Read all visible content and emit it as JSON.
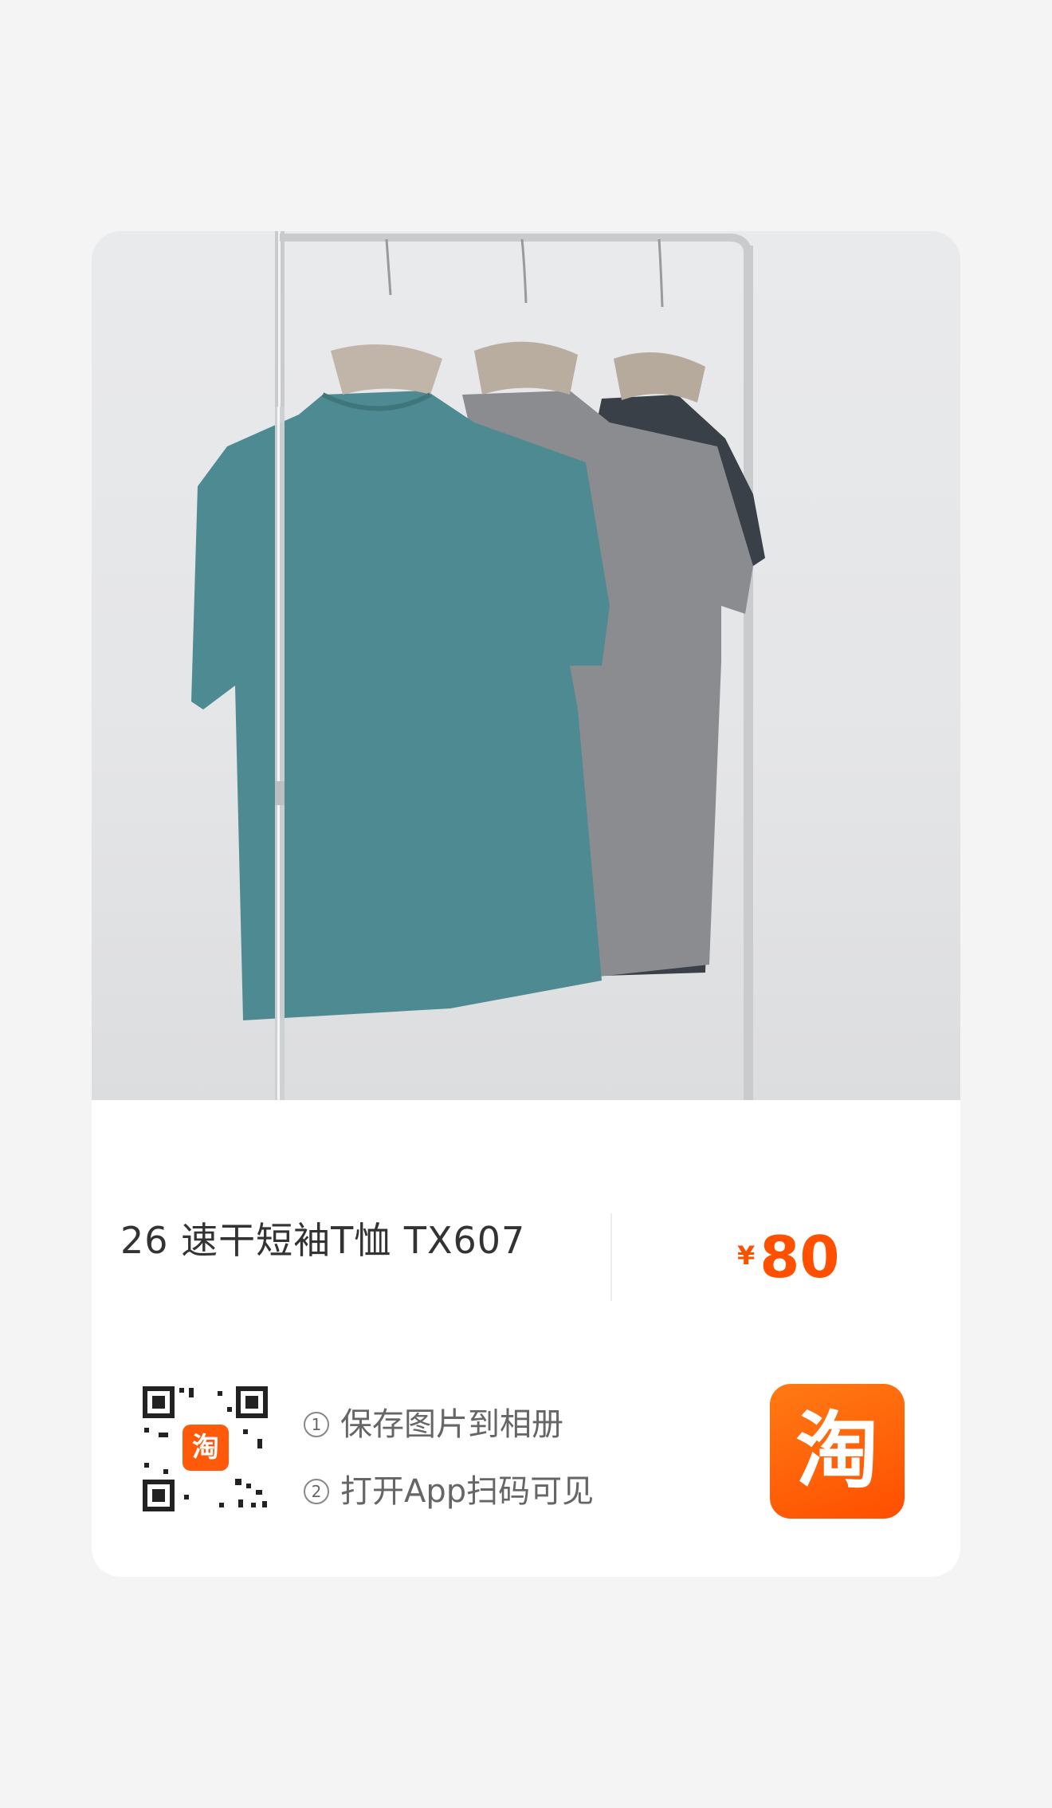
{
  "product": {
    "title": "26 速干短袖T恤 TX607",
    "currency": "¥",
    "price": "80",
    "photo_description_icon": "product-photo"
  },
  "share": {
    "step1_num": "1",
    "step1": "保存图片到相册",
    "step2_num": "2",
    "step2": "打开App扫码可见",
    "qr_logo_char": "淘",
    "app_logo_char": "淘"
  },
  "colors": {
    "accent": "#ff5000",
    "shirt_teal": "#4d8a91",
    "shirt_gray": "#8a8c90",
    "shirt_dark": "#3a4047"
  }
}
